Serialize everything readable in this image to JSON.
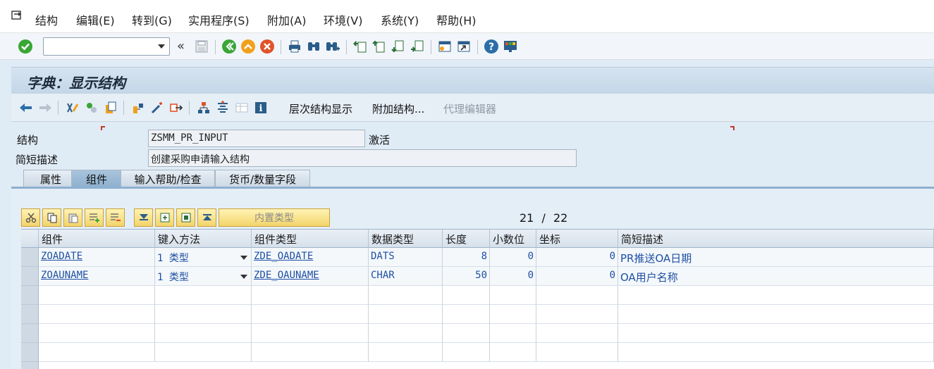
{
  "menubar": {
    "items": [
      "结构",
      "编辑(E)",
      "转到(G)",
      "实用程序(S)",
      "附加(A)",
      "环境(V)",
      "系统(Y)",
      "帮助(H)"
    ]
  },
  "toolbar": {
    "command_value": "",
    "chevron": "«",
    "icons": [
      "check-icon",
      "save-icon",
      "back-icon",
      "exit-icon",
      "cancel-icon",
      "print-icon",
      "find-icon",
      "find-next-icon",
      "first-page-icon",
      "prev-page-icon",
      "next-page-icon",
      "last-page-icon",
      "new-session-icon",
      "shortcut-icon",
      "help-icon",
      "customize-icon"
    ]
  },
  "title": "字典：显示结构",
  "app_toolbar": {
    "buttons": [
      "层次结构显示",
      "附加结构...",
      "代理编辑器"
    ]
  },
  "form": {
    "structure_label": "结构",
    "structure_value": "ZSMM_PR_INPUT",
    "status": "激活",
    "desc_label": "简短描述",
    "desc_value": "创建采购申请输入结构"
  },
  "tabs": [
    "属性",
    "组件",
    "输入帮助/检查",
    "货币/数量字段"
  ],
  "active_tab": 1,
  "table_tools": {
    "builtin_type": "内置类型"
  },
  "pager": {
    "current": "21",
    "sep": "/",
    "total": "22"
  },
  "table": {
    "headers": [
      "组件",
      "键入方法",
      "组件类型",
      "数据类型",
      "长度",
      "小数位",
      "坐标",
      "简短描述"
    ],
    "rows": [
      [
        "ZOADATE",
        "1 类型",
        "ZDE_OADATE",
        "DATS",
        "8",
        "0",
        "0",
        "PR推送OA日期"
      ],
      [
        "ZOAUNAME",
        "1 类型",
        "ZDE_OAUNAME",
        "CHAR",
        "50",
        "0",
        "0",
        "OA用户名称"
      ]
    ]
  },
  "colors": {
    "accent_blue": "#1f4fa3",
    "title_bg": "#c3d6e8",
    "corner_red": "#c0392b",
    "tool_yellow": "#f3d46a"
  }
}
